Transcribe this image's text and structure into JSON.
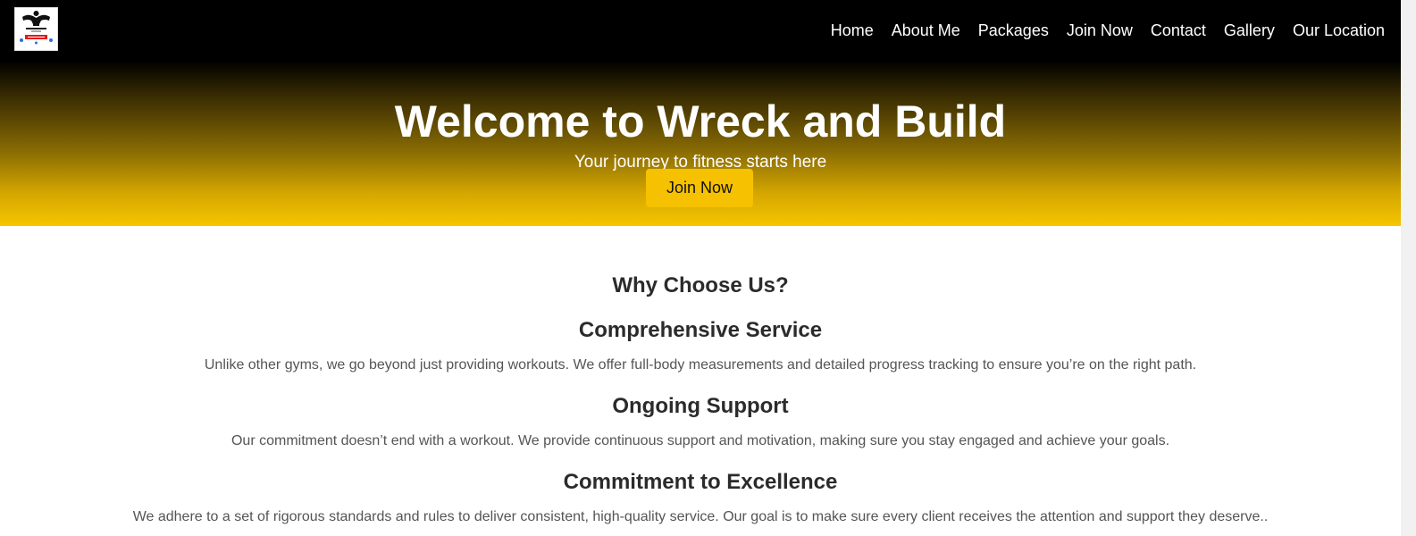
{
  "brand": {
    "logo_text": "Wreck & build",
    "logo_icon": "bodybuilder-logo"
  },
  "nav": {
    "items": [
      "Home",
      "About Me",
      "Packages",
      "Join Now",
      "Contact",
      "Gallery",
      "Our Location"
    ]
  },
  "hero": {
    "title": "Welcome to Wreck and Build",
    "subtitle": "Your journey to fitness starts here",
    "cta_label": "Join Now"
  },
  "why": {
    "title": "Why Choose Us?",
    "features": [
      {
        "title": "Comprehensive Service",
        "description": "Unlike other gyms, we go beyond just providing workouts. We offer full-body measurements and detailed progress tracking to ensure you’re on the right path."
      },
      {
        "title": "Ongoing Support",
        "description": "Our commitment doesn’t end with a workout. We provide continuous support and motivation, making sure you stay engaged and achieve your goals."
      },
      {
        "title": "Commitment to Excellence",
        "description": "We adhere to a set of rigorous standards and rules to deliver consistent, high-quality service. Our goal is to make sure every client receives the attention and support they deserve.."
      }
    ]
  },
  "colors": {
    "header_bg": "#000000",
    "accent_yellow": "#f6c100",
    "heading_text": "#2b2b2b",
    "body_text": "#555555"
  }
}
